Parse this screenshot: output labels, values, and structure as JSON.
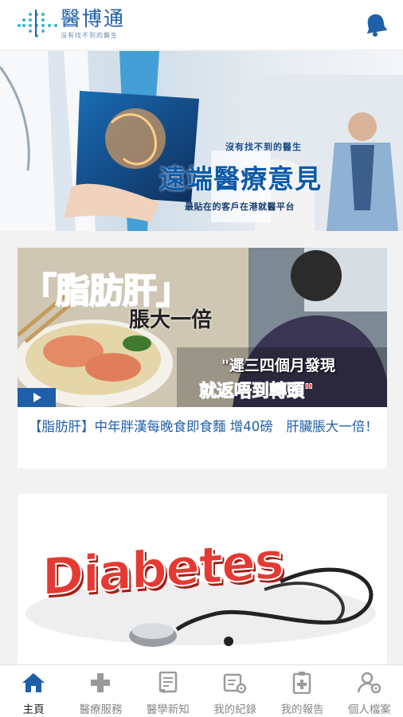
{
  "header": {
    "logo_title": "醫博通",
    "logo_subtitle": "沒有找不到的醫生",
    "accent": "#1f5fa8"
  },
  "hero": {
    "tagline": "沒有找不到的醫生",
    "title": "遠端醫療意見",
    "subtitle": "最貼在的客戶在港就醫平台"
  },
  "articles": [
    {
      "image_title": "「脂肪肝」",
      "image_subtitle": "脹大一倍",
      "image_quote_1": "\"遲三四個月發現",
      "image_quote_2": "就返唔到轉頭\"",
      "has_video": true,
      "headline": "【脂肪肝】中年胖漢每晚食即食麵 增40磅　肝臟脹大一倍！"
    },
    {
      "image_title": "Diabetes"
    }
  ],
  "bottom_nav": {
    "items": [
      {
        "label": "主頁",
        "icon": "home-icon",
        "active": true
      },
      {
        "label": "醫療服務",
        "icon": "plus-icon",
        "active": false
      },
      {
        "label": "醫學新知",
        "icon": "document-icon",
        "active": false
      },
      {
        "label": "我的紀錄",
        "icon": "records-icon",
        "active": false
      },
      {
        "label": "我的報告",
        "icon": "report-icon",
        "active": false
      },
      {
        "label": "個人檔案",
        "icon": "profile-settings-icon",
        "active": false
      }
    ],
    "active_color": "#1f5fa8",
    "inactive_color": "#9a9a9a"
  }
}
